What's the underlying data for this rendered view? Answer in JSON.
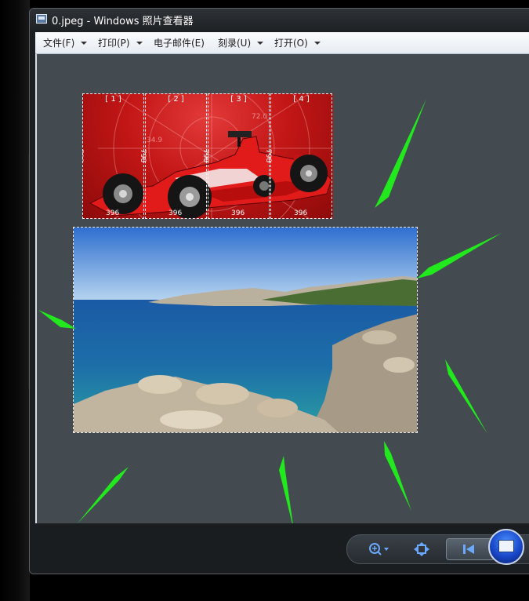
{
  "window": {
    "title": "0.jpeg - Windows 照片查看器"
  },
  "menu": [
    {
      "label": "文件(F)",
      "dropdown": true
    },
    {
      "label": "打印(P)",
      "dropdown": true
    },
    {
      "label": "电子邮件(E)",
      "dropdown": false
    },
    {
      "label": "刻录(U)",
      "dropdown": true
    },
    {
      "label": "打开(O)",
      "dropdown": true
    }
  ],
  "car_photo": {
    "panels": [
      {
        "label": "[ 1 ]",
        "width": "396",
        "height": "798"
      },
      {
        "label": "[ 2 ]",
        "width": "396",
        "height": "798"
      },
      {
        "label": "[ 3 ]",
        "width": "396",
        "height": "798"
      },
      {
        "label": "[ 4 ]",
        "width": "396",
        "height": "798"
      }
    ],
    "bg_numbers": [
      "34.9",
      "72.0"
    ]
  },
  "controls": {
    "zoom_icon": "magnifier-icon",
    "fit_icon": "actual-size-icon",
    "prev_icon": "previous-icon",
    "slideshow_icon": "slideshow-icon"
  },
  "colors": {
    "arrow": "#22e81e",
    "canvas": "#434b50"
  }
}
